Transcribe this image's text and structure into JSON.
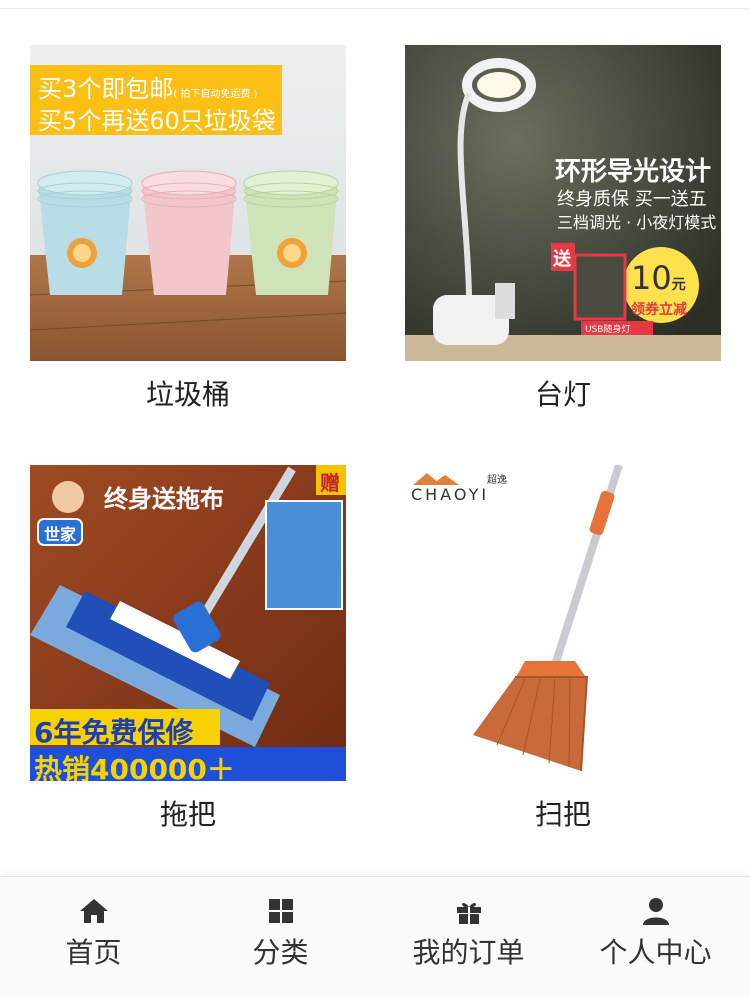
{
  "products": [
    {
      "name": "垃圾桶",
      "promo_line1": "买3个即包邮",
      "promo_note": "( 拍下自动免运费 )",
      "promo_line2": "买5个再送60只垃圾袋"
    },
    {
      "name": "台灯",
      "promo_title": "环形导光设计",
      "promo_sub1": "终身质保 买一送五",
      "promo_sub2": "三档调光 · 小夜灯模式",
      "gift_label": "送",
      "coupon_value": "10",
      "coupon_unit": "元",
      "coupon_text": "领券立减",
      "usb_label": "USB随身灯"
    },
    {
      "name": "拖把",
      "banner": "终身送拖布",
      "brand": "世家",
      "gift_badge": "赠",
      "warranty": "6年免费保修",
      "sales": "热销400000＋"
    },
    {
      "name": "扫把",
      "brand_en": "CHAOYI",
      "brand_cn": "超逸"
    }
  ],
  "tabbar": [
    {
      "label": "首页",
      "icon": "home-icon"
    },
    {
      "label": "分类",
      "icon": "grid-icon"
    },
    {
      "label": "我的订单",
      "icon": "gift-icon"
    },
    {
      "label": "个人中心",
      "icon": "user-icon"
    }
  ]
}
